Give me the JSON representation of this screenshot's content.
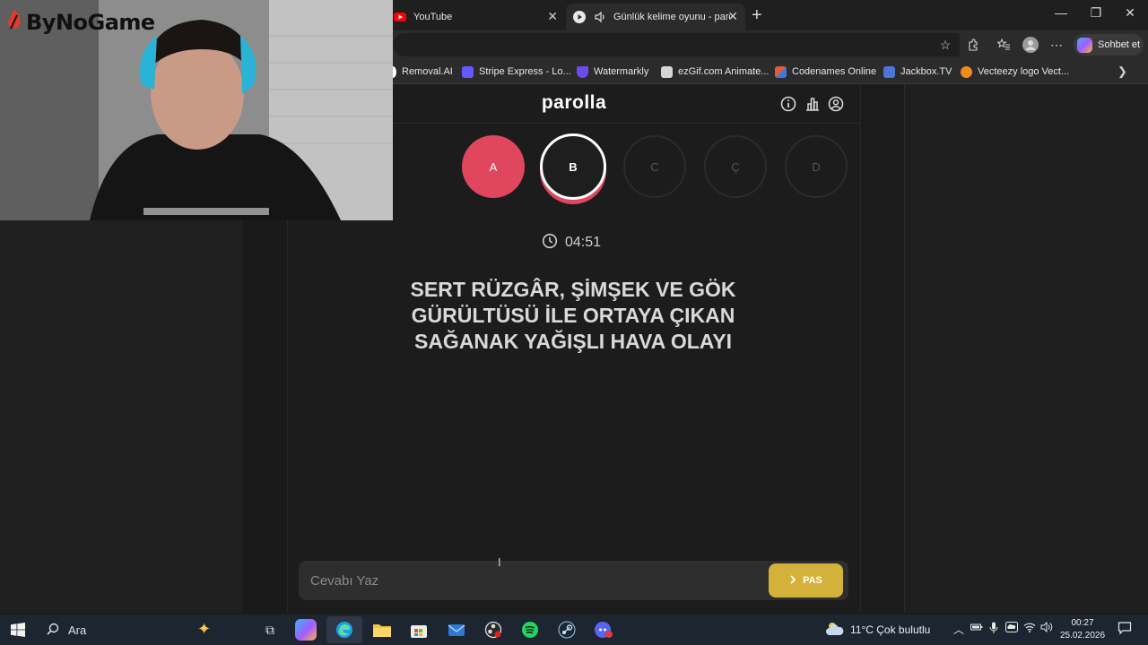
{
  "browser": {
    "tabs": [
      {
        "label": "YouTube",
        "icon": "youtube-icon",
        "active": false
      },
      {
        "label": "Günlük kelime oyunu - parolla",
        "icon": "parolla-icon",
        "active": true
      }
    ],
    "copilot_label": "Sohbet et",
    "bookmarks": [
      {
        "label": "Removal.AI",
        "color": "#ffffff"
      },
      {
        "label": "Stripe Express - Lo...",
        "color": "#635bff"
      },
      {
        "label": "Watermarkly",
        "color": "#6a4de6"
      },
      {
        "label": "ezGif.com Animate...",
        "color": "#e0e0e0"
      },
      {
        "label": "Codenames Online",
        "color": "#e05a3c"
      },
      {
        "label": "Jackbox.TV",
        "color": "#4a76d8"
      },
      {
        "label": "Vecteezy logo Vect...",
        "color": "#f38a1e"
      }
    ]
  },
  "app": {
    "title": "parolla",
    "letters": [
      {
        "label": "A",
        "state": "done"
      },
      {
        "label": "B",
        "state": "active"
      },
      {
        "label": "C",
        "state": "idle"
      },
      {
        "label": "Ç",
        "state": "idle"
      },
      {
        "label": "D",
        "state": "idle"
      }
    ],
    "timer": "04:51",
    "question": "SERT RÜZGÂR, ŞİMŞEK VE GÖK GÜRÜLTÜSÜ İLE ORTAYA ÇIKAN SAĞANAK YAĞIŞLI HAVA OLAYI",
    "answer_placeholder": "Cevabı Yaz",
    "pass_label": "PAS",
    "accent": "#e0475f",
    "pass_color": "#d4b23a"
  },
  "overlay": {
    "logo_text": "ByNoGame"
  },
  "taskbar": {
    "search_label": "Ara",
    "weather": "11°C  Çok bulutlu",
    "time": "00:27",
    "date": "25.02.2026"
  }
}
